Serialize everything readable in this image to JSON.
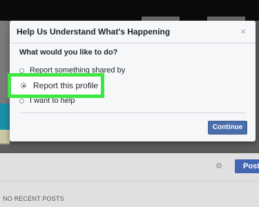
{
  "dialog": {
    "title": "Help Us Understand What's Happening",
    "close": "×",
    "question": "What would you like to do?",
    "options": [
      {
        "label": "Report something shared by",
        "selected": false
      },
      {
        "label": "Report this profile",
        "selected": true
      },
      {
        "label": "I want to help",
        "selected": false
      }
    ],
    "continue_label": "Continue"
  },
  "background": {
    "post_label": "Post",
    "no_recent_posts": "NO RECENT POSTS",
    "gear_icon": "gear-icon"
  },
  "colors": {
    "highlight": "#3ee641",
    "button": "#4a6eaa"
  }
}
